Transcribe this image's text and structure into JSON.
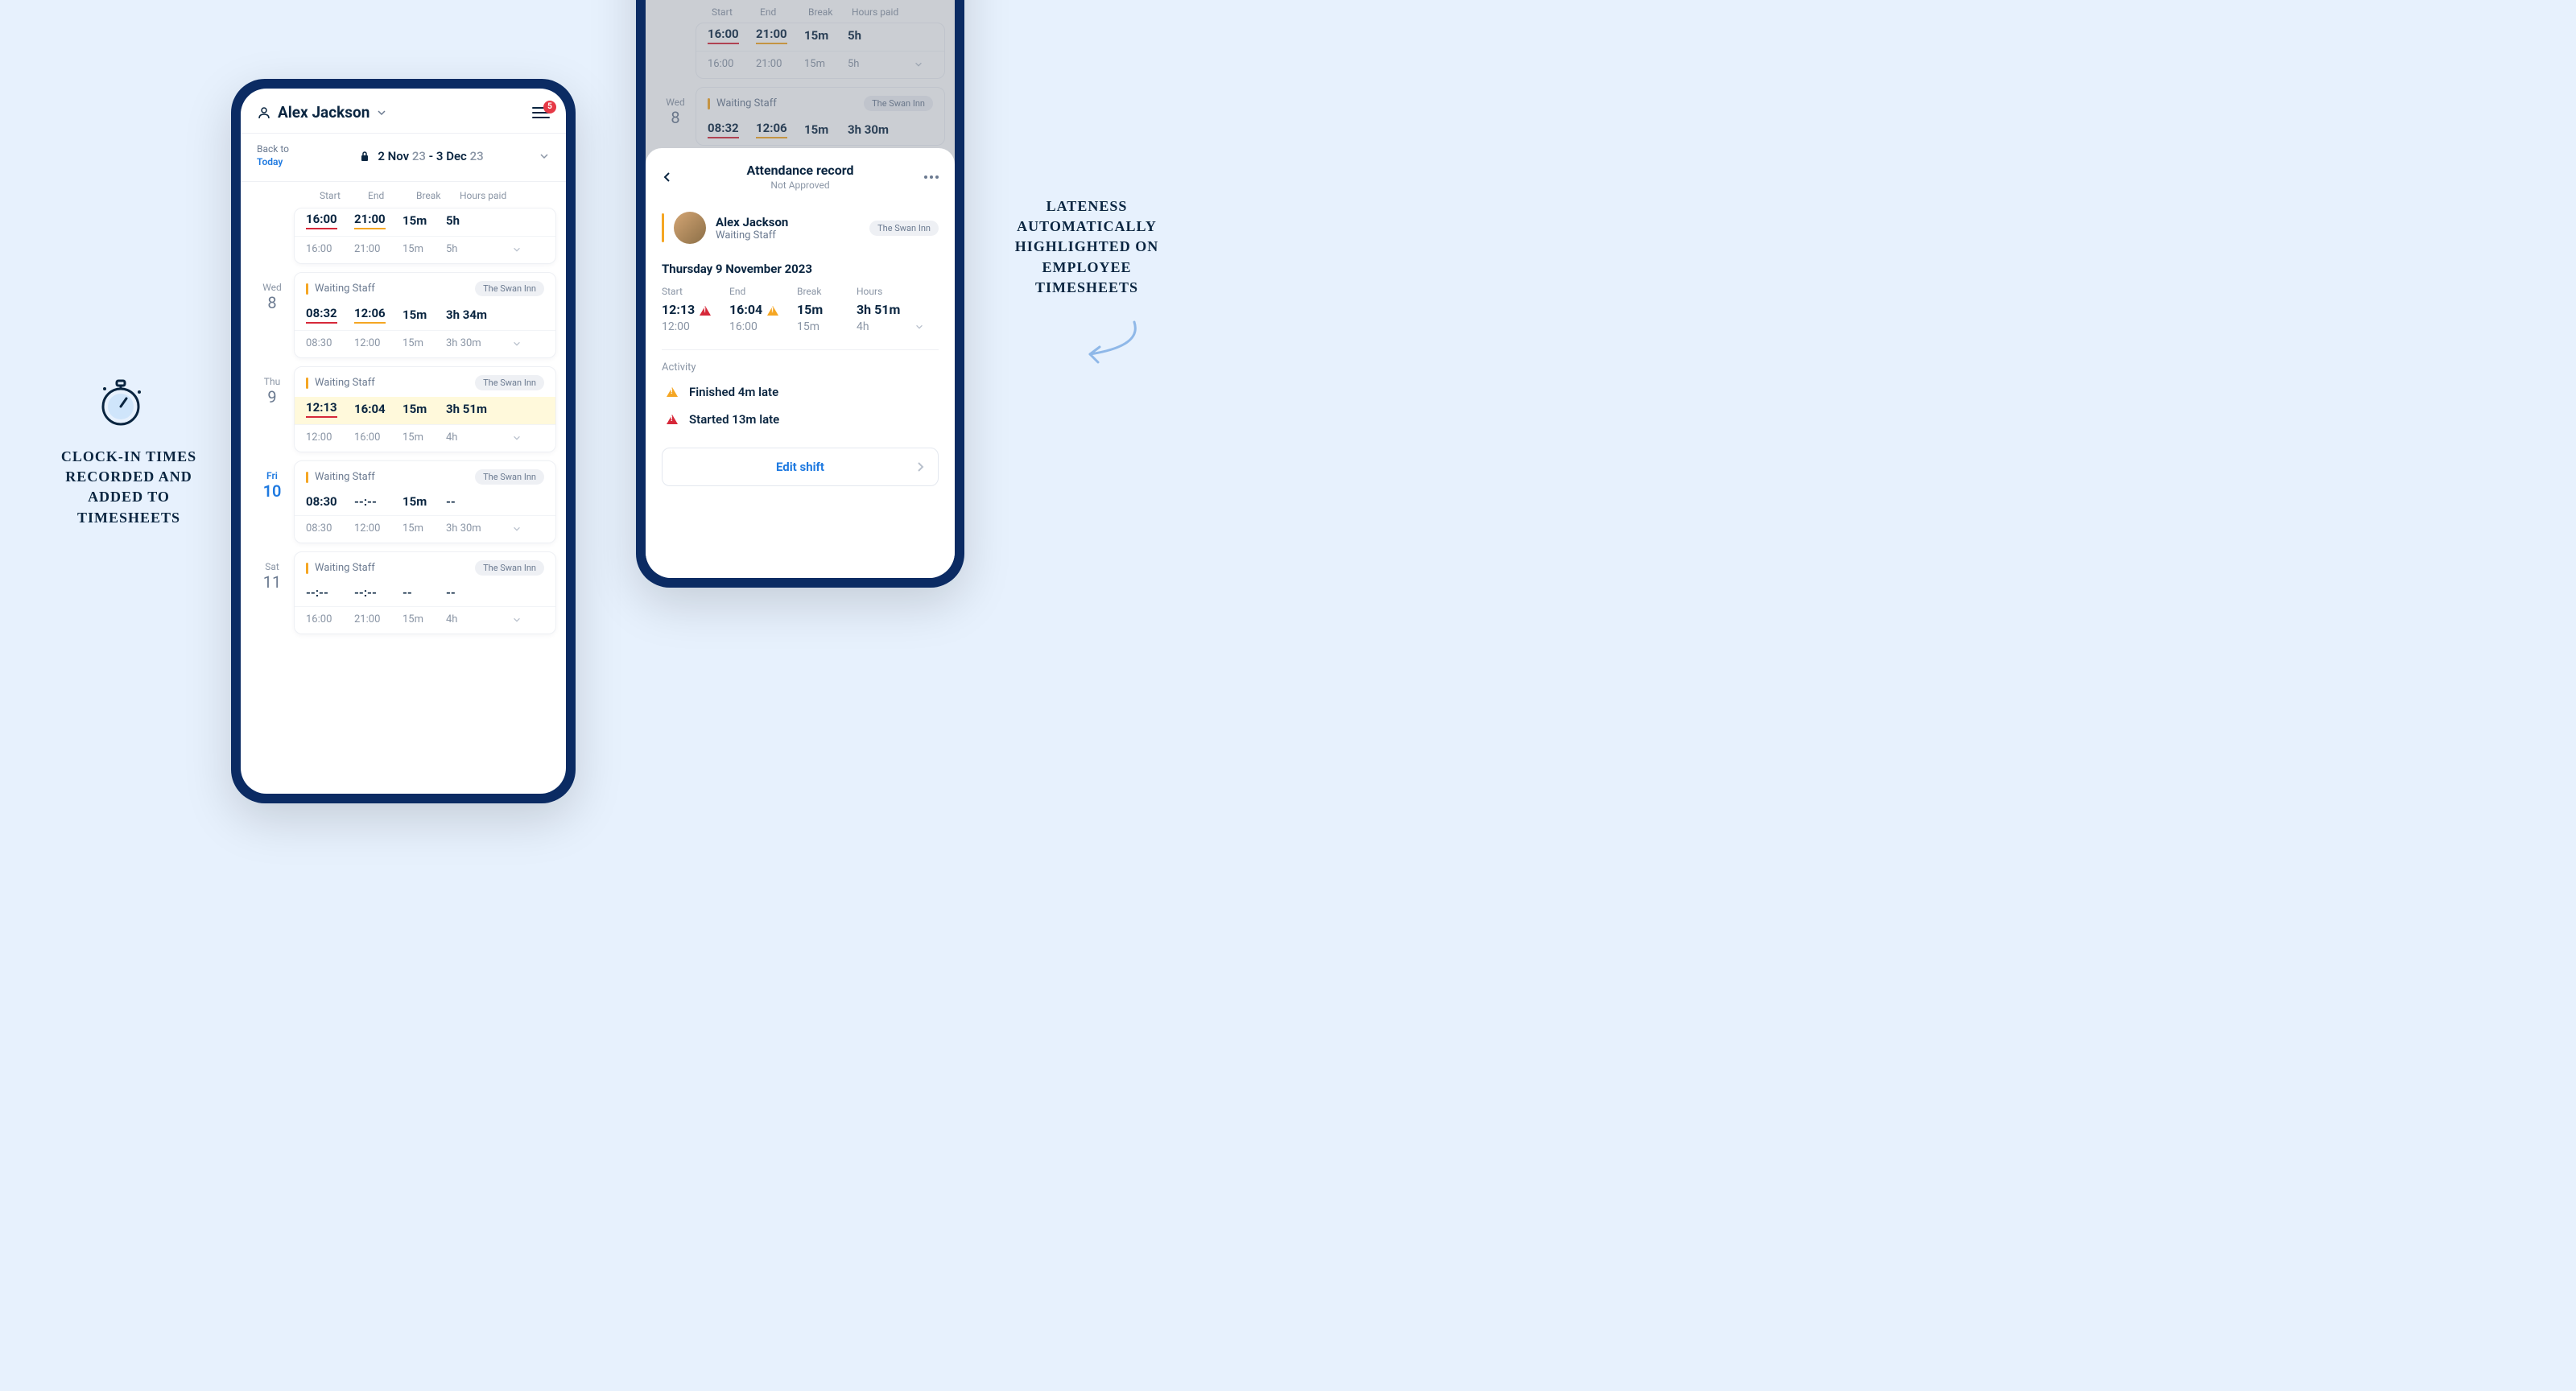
{
  "callouts": {
    "left": "Clock-in times recorded and added to timesheets",
    "right": "Lateness automatically highlighted on employee timesheets"
  },
  "phone1": {
    "header": {
      "name": "Alex Jackson",
      "badge": "5"
    },
    "dateline": {
      "back": "Back to",
      "today": "Today",
      "from": "2 Nov",
      "fromYear": "23",
      "to": "3 Dec",
      "toYear": "23"
    },
    "cols": {
      "start": "Start",
      "end": "End",
      "break": "Break",
      "hours": "Hours paid"
    },
    "role": "Waiting Staff",
    "venue": "The Swan Inn",
    "days": [
      {
        "dow": "",
        "num": "",
        "actual": {
          "start": "16:00",
          "end": "21:00",
          "break": "15m",
          "hours": "5h",
          "startUL": "red",
          "endUL": "orange"
        },
        "sched": {
          "start": "16:00",
          "end": "21:00",
          "break": "15m",
          "hours": "5h"
        },
        "showTop": false
      },
      {
        "dow": "Wed",
        "num": "8",
        "actual": {
          "start": "08:32",
          "end": "12:06",
          "break": "15m",
          "hours": "3h 34m",
          "startUL": "red",
          "endUL": "orange"
        },
        "sched": {
          "start": "08:30",
          "end": "12:00",
          "break": "15m",
          "hours": "3h 30m"
        },
        "showTop": true
      },
      {
        "dow": "Thu",
        "num": "9",
        "actual": {
          "start": "12:13",
          "end": "16:04",
          "break": "15m",
          "hours": "3h 51m",
          "startUL": "red",
          "highlight": true
        },
        "sched": {
          "start": "12:00",
          "end": "16:00",
          "break": "15m",
          "hours": "4h"
        },
        "showTop": true
      },
      {
        "dow": "Fri",
        "num": "10",
        "active": true,
        "comment": true,
        "actual": {
          "start": "08:30",
          "end": "--:--",
          "break": "15m",
          "hours": "--"
        },
        "sched": {
          "start": "08:30",
          "end": "12:00",
          "break": "15m",
          "hours": "3h 30m"
        },
        "showTop": true
      },
      {
        "dow": "Sat",
        "num": "11",
        "actual": {
          "start": "--:--",
          "end": "--:--",
          "break": "--",
          "hours": "--"
        },
        "sched": {
          "start": "16:00",
          "end": "21:00",
          "break": "15m",
          "hours": "4h"
        },
        "showTop": true
      }
    ]
  },
  "phone2": {
    "bg": {
      "cols": {
        "start": "Start",
        "end": "End",
        "break": "Break",
        "hours": "Hours paid"
      },
      "days": [
        {
          "dow": "",
          "num": "",
          "actual": {
            "start": "16:00",
            "end": "21:00",
            "break": "15m",
            "hours": "5h",
            "startUL": "red",
            "endUL": "orange"
          },
          "sched": {
            "start": "16:00",
            "end": "21:00",
            "break": "15m",
            "hours": "5h"
          }
        },
        {
          "dow": "Wed",
          "num": "8",
          "actual": {
            "start": "08:32",
            "end": "12:06",
            "break": "15m",
            "hours": "3h 30m",
            "startUL": "red",
            "endUL": "orange"
          },
          "role": "Waiting Staff",
          "venue": "The Swan Inn"
        }
      ]
    },
    "sheet": {
      "title": "Attendance record",
      "sub": "Not Approved",
      "person": {
        "name": "Alex Jackson",
        "role": "Waiting Staff",
        "venue": "The Swan Inn"
      },
      "date": "Thursday 9 November 2023",
      "cols": {
        "start": "Start",
        "end": "End",
        "break": "Break",
        "hours": "Hours"
      },
      "actual": {
        "start": "12:13",
        "end": "16:04",
        "break": "15m",
        "hours": "3h 51m"
      },
      "sched": {
        "start": "12:00",
        "end": "16:00",
        "break": "15m",
        "hours": "4h"
      },
      "activityLabel": "Activity",
      "activity": [
        {
          "type": "orange",
          "text": "Finished 4m late"
        },
        {
          "type": "red",
          "text": "Started 13m late"
        }
      ],
      "editLabel": "Edit shift"
    }
  }
}
